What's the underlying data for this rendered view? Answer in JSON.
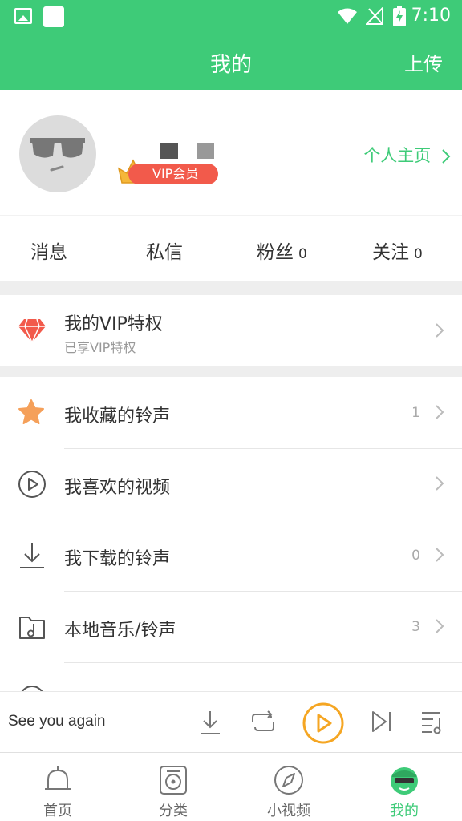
{
  "statusbar": {
    "time": "7:10"
  },
  "appbar": {
    "title": "我的",
    "upload_label": "上传"
  },
  "profile": {
    "vip_badge": "VIP会员",
    "homepage_link": "个人主页"
  },
  "stats": [
    {
      "label": "消息",
      "count": ""
    },
    {
      "label": "私信",
      "count": ""
    },
    {
      "label": "粉丝",
      "count": "0"
    },
    {
      "label": "关注",
      "count": "0"
    }
  ],
  "vip_row": {
    "title": "我的VIP特权",
    "subtitle": "已享VIP特权"
  },
  "menu": [
    {
      "label": "我收藏的铃声",
      "count": "1",
      "icon": "star-icon"
    },
    {
      "label": "我喜欢的视频",
      "count": "",
      "icon": "play-circle-icon"
    },
    {
      "label": "我下载的铃声",
      "count": "0",
      "icon": "download-icon"
    },
    {
      "label": "本地音乐/铃声",
      "count": "3",
      "icon": "music-folder-icon"
    }
  ],
  "player": {
    "song": "See you again"
  },
  "tabs": [
    {
      "label": "首页",
      "icon": "bell-icon",
      "active": false
    },
    {
      "label": "分类",
      "icon": "speaker-icon",
      "active": false
    },
    {
      "label": "小视频",
      "icon": "compass-icon",
      "active": false
    },
    {
      "label": "我的",
      "icon": "avatar-icon",
      "active": true
    }
  ],
  "colors": {
    "brand_green": "#3ecb78",
    "vip_red": "#f25a4b",
    "accent_orange": "#f5a623"
  }
}
